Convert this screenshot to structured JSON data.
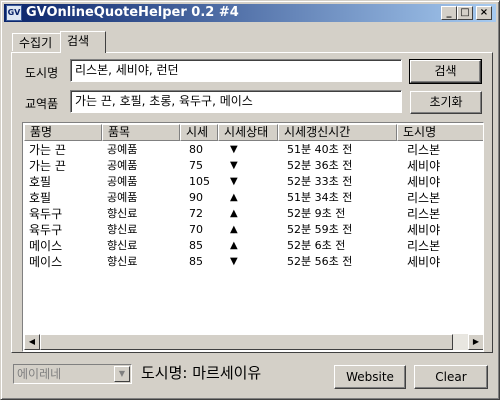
{
  "window": {
    "title": "GVOnlineQuoteHelper 0.2 #4",
    "icon": "gv-app-icon",
    "controls": {
      "minimize": "_",
      "maximize": "□",
      "close": "×"
    }
  },
  "tabs": [
    {
      "label": "수집기",
      "active": false
    },
    {
      "label": "검색",
      "active": true
    }
  ],
  "search": {
    "city_label": "도시명",
    "city_value": "리스본, 세비야, 런던",
    "goods_label": "교역품",
    "goods_value": "가는 끈, 호필, 초롱, 육두구, 메이스",
    "search_button": "검색",
    "reset_button": "초기화"
  },
  "table": {
    "columns": [
      "품명",
      "품목",
      "시세",
      "시세상태",
      "시세갱신시간",
      "도시명"
    ],
    "rows": [
      {
        "name": "가는 끈",
        "category": "공예품",
        "price": "80",
        "trend": "▼",
        "updated": "51분 40초 전",
        "city": "리스본"
      },
      {
        "name": "가는 끈",
        "category": "공예품",
        "price": "75",
        "trend": "▼",
        "updated": "52분 36초 전",
        "city": "세비야"
      },
      {
        "name": "호필",
        "category": "공예품",
        "price": "105",
        "trend": "▼",
        "updated": "52분 33초 전",
        "city": "세비야"
      },
      {
        "name": "호필",
        "category": "공예품",
        "price": "90",
        "trend": "▲",
        "updated": "51분 34초 전",
        "city": "리스본"
      },
      {
        "name": "육두구",
        "category": "향신료",
        "price": "72",
        "trend": "▲",
        "updated": "52분 9초 전",
        "city": "리스본"
      },
      {
        "name": "육두구",
        "category": "향신료",
        "price": "70",
        "trend": "▲",
        "updated": "52분 59초 전",
        "city": "세비야"
      },
      {
        "name": "메이스",
        "category": "향신료",
        "price": "85",
        "trend": "▲",
        "updated": "52분 6초 전",
        "city": "리스본"
      },
      {
        "name": "메이스",
        "category": "향신료",
        "price": "85",
        "trend": "▼",
        "updated": "52분 56초 전",
        "city": "세비야"
      }
    ]
  },
  "scrollbar": {
    "left_arrow": "◀",
    "right_arrow": "▶"
  },
  "footer": {
    "combo_value": "에이레네",
    "combo_arrow": "▼",
    "city_status": "도시명: 마르세이유",
    "website_button": "Website",
    "clear_button": "Clear"
  }
}
